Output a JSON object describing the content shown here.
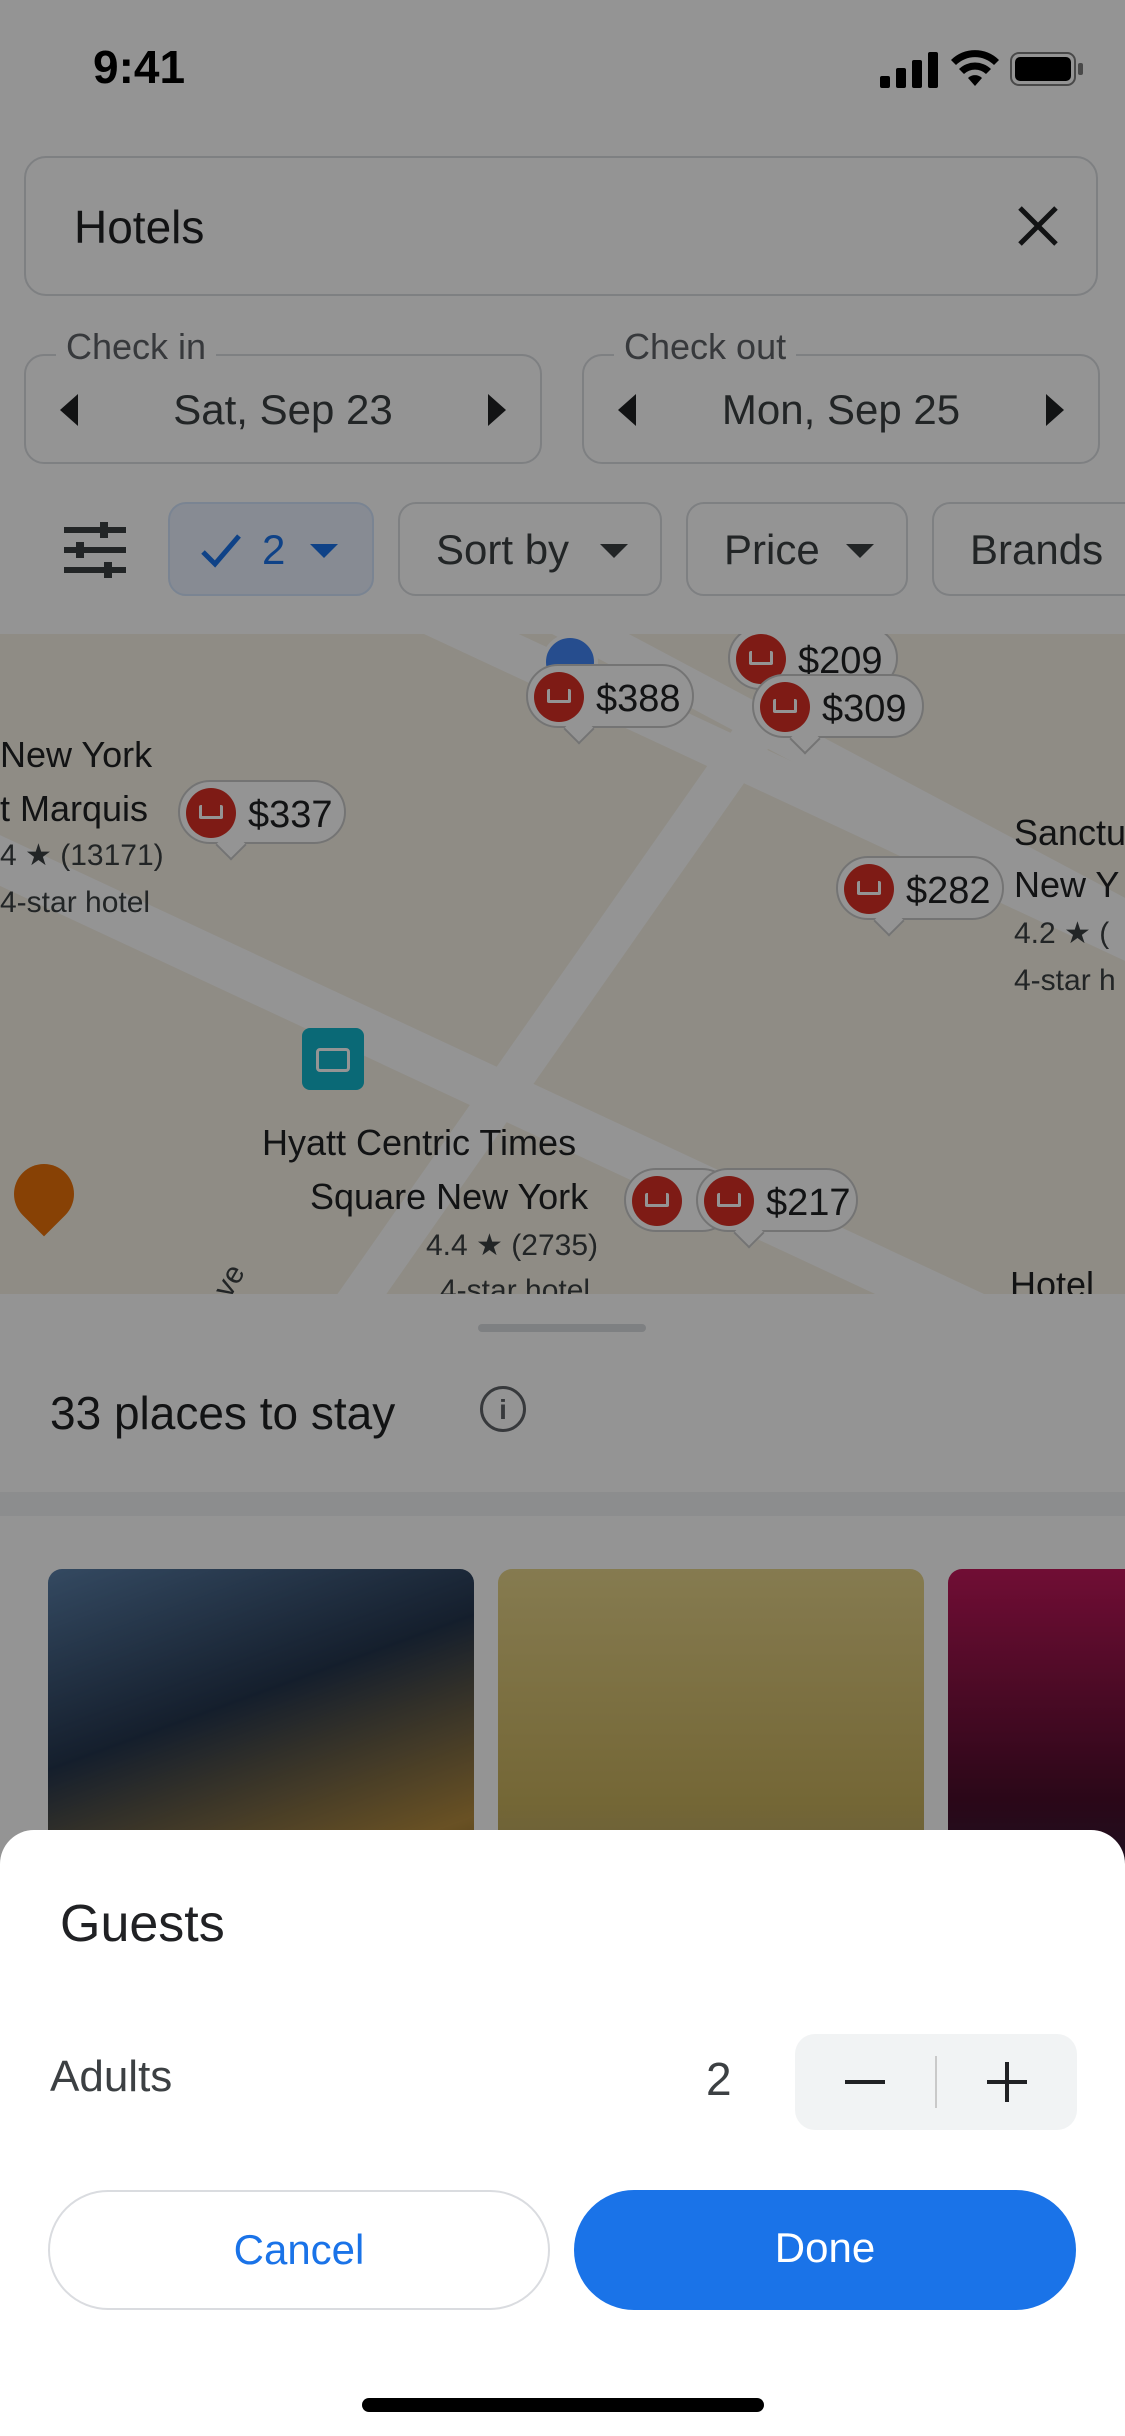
{
  "status_bar": {
    "time": "9:41"
  },
  "search": {
    "query": "Hotels",
    "clear_icon": "close-icon"
  },
  "dates": {
    "check_in": {
      "label": "Check in",
      "value": "Sat, Sep 23"
    },
    "check_out": {
      "label": "Check out",
      "value": "Mon, Sep 25"
    }
  },
  "filters": {
    "guests_chip": "2",
    "sort_chip": "Sort by",
    "price_chip": "Price",
    "brands_chip": "Brands"
  },
  "map": {
    "pins": [
      {
        "price": "$388"
      },
      {
        "price": "$209"
      },
      {
        "price": "$309"
      },
      {
        "price": "$337"
      },
      {
        "price": "$282"
      },
      {
        "price": "$217"
      }
    ],
    "labels": {
      "marquis_line1": "New York",
      "marquis_line2": "t Marquis",
      "marquis_rating": "4 ★ (13171)",
      "marquis_class": "4-star hotel",
      "sanct_line1": "Sanctu",
      "sanct_line2": "New Y",
      "sanct_rating": "4.2 ★ (",
      "sanct_class": "4-star h",
      "hyatt_line1": "Hyatt Centric Times",
      "hyatt_line2": "Square New York",
      "hyatt_rating": "4.4 ★ (2735)",
      "hyatt_class": "4-star hotel",
      "hotel_s": "Hotel S",
      "street": "ve"
    }
  },
  "list": {
    "count_text": "33 places to stay",
    "info_glyph": "i"
  },
  "guests_sheet": {
    "title": "Guests",
    "adults_label": "Adults",
    "adults_value": "2",
    "cancel_label": "Cancel",
    "done_label": "Done"
  },
  "colors": {
    "accent": "#1a73e8",
    "pin_red": "#d93025"
  }
}
